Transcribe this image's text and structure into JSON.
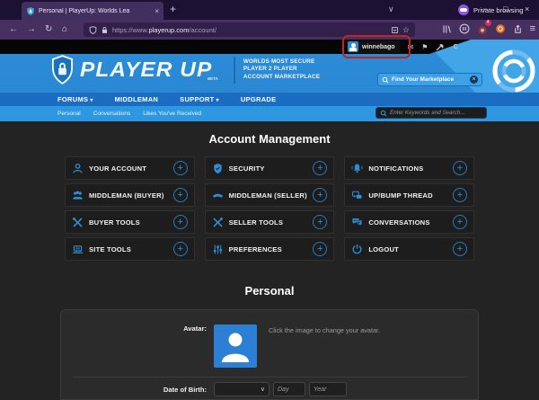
{
  "browser": {
    "tab_title": "Personal | PlayerUp: Worlds Lea",
    "private_label": "Private browsing",
    "url_prefix": "https://www.",
    "url_domain": "playerup.com",
    "url_path": "/account/",
    "extension_badge_count": "4"
  },
  "icons": {
    "back": "←",
    "forward": "→",
    "reload": "↻",
    "home": "⌂",
    "star": "☆",
    "menu": "≡",
    "minimize": "−",
    "maximize": "□",
    "close": "×",
    "tab_close": "×",
    "new_tab": "+",
    "tab_chevron": "∨",
    "caret_down": "▾",
    "select_chevron": "∨",
    "flag": "⚑",
    "envelope": "✉",
    "plus": "+",
    "clear_x": "×",
    "pause": "II"
  },
  "page": {
    "user_bar": {
      "username": "winnebago",
      "partial_link": "C"
    },
    "logo": {
      "name": "PLAYER UP",
      "beta": "BETA",
      "tagline": [
        "WORLDS MOST SECURE",
        "PLAYER 2 PLAYER",
        "ACCOUNT MARKETPLACE"
      ]
    },
    "marketplace_search_placeholder": "Find Your Marketplace",
    "keyword_search_placeholder": "Enter Keywords and Search...",
    "nav": [
      {
        "label": "FORUMS"
      },
      {
        "label": "MIDDLEMAN"
      },
      {
        "label": "SUPPORT"
      },
      {
        "label": "UPGRADE"
      }
    ],
    "subnav": [
      {
        "label": "Personal"
      },
      {
        "label": "Conversations"
      },
      {
        "label": "Likes You've Received"
      }
    ],
    "account_management": {
      "title": "Account Management",
      "items": [
        {
          "label": "YOUR ACCOUNT",
          "icon": "user-icon"
        },
        {
          "label": "SECURITY",
          "icon": "shield-icon"
        },
        {
          "label": "NOTIFICATIONS",
          "icon": "bell-icon"
        },
        {
          "label": "MIDDLEMAN (BUYER)",
          "icon": "group-icon"
        },
        {
          "label": "MIDDLEMAN (SELLER)",
          "icon": "handshake-icon"
        },
        {
          "label": "UP/BUMP THREAD",
          "icon": "speech-bubbles-icon"
        },
        {
          "label": "BUYER TOOLS",
          "icon": "tools-icon"
        },
        {
          "label": "SELLER TOOLS",
          "icon": "tools-icon"
        },
        {
          "label": "CONVERSATIONS",
          "icon": "chat-icon"
        },
        {
          "label": "SITE TOOLS",
          "icon": "laptop-icon"
        },
        {
          "label": "PREFERENCES",
          "icon": "sliders-icon"
        },
        {
          "label": "LOGOUT",
          "icon": "power-icon"
        }
      ]
    },
    "personal": {
      "title": "Personal",
      "avatar_label": "Avatar:",
      "avatar_hint": "Click the image to change your avatar.",
      "dob_label": "Date of Birth:",
      "day_placeholder": "Day",
      "year_placeholder": "Year"
    }
  },
  "colors": {
    "header_blue": "#2b8ad6",
    "light_blue": "#42a5e8",
    "nav_blue": "#1a6dc0",
    "subnav_blue": "#2d97e2",
    "tile_icon_blue": "#2f8fd6",
    "highlight_red": "#c3241f",
    "avatar_blue": "#2b7fd4"
  }
}
